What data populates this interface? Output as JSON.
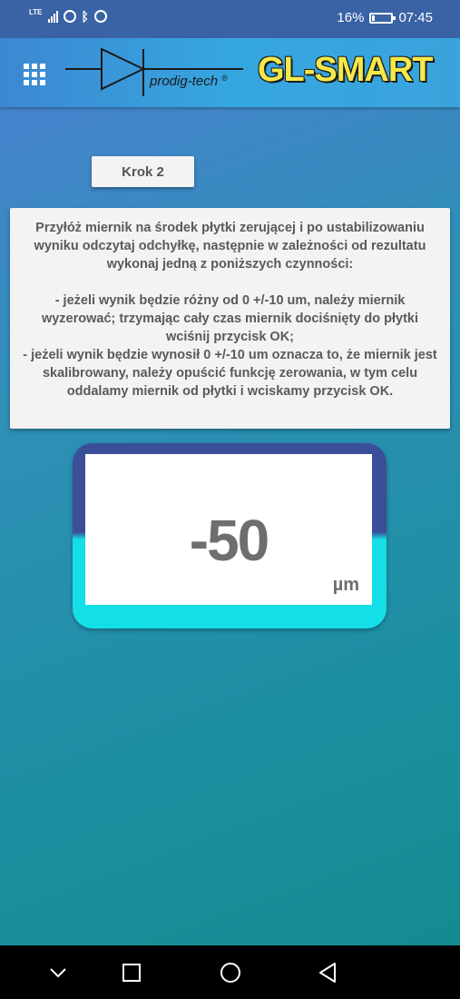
{
  "status_bar": {
    "network_label": "LTE",
    "battery_percent": "16%",
    "battery_level": 0.16,
    "time": "07:45",
    "icons": [
      "lte-signal-icon",
      "alarm-icon",
      "bluetooth-icon",
      "whatsapp-icon",
      "battery-icon"
    ]
  },
  "header": {
    "menu_icon": "grid-menu-icon",
    "logo_text": "prodig-tech",
    "logo_mark": "®",
    "brand": "GL-SMART"
  },
  "step": {
    "label": "Krok 2"
  },
  "instructions": {
    "intro": "Przyłóż miernik na środek płytki zerującej i po ustabilizowaniu wyniku odczytaj odchyłkę, następnie w zależności od rezultatu wykonaj jedną z poniższych czynności:",
    "option_1": "- jeżeli wynik będzie różny od 0 +/-10 um, należy miernik wyzerować; trzymając cały czas miernik dociśnięty do płytki wciśnij przycisk OK;",
    "option_2": "- jeżeli wynik będzie wynosił 0 +/-10 um oznacza to, że miernik jest skalibrowany, należy opuścić funkcję zerowania, w tym celu oddalamy miernik od płytki i wciskamy przycisk OK."
  },
  "meter": {
    "value": "-50",
    "unit": "µm"
  },
  "nav": {
    "icons": [
      "chevron-down-icon",
      "recent-apps-icon",
      "home-icon",
      "back-icon"
    ]
  },
  "colors": {
    "header_bg": "#36a6e0",
    "brand_yellow": "#f5e84a",
    "meter_dark": "#3a4f98",
    "meter_cyan": "#14dfe6",
    "card_bg": "#f3f3f3"
  }
}
